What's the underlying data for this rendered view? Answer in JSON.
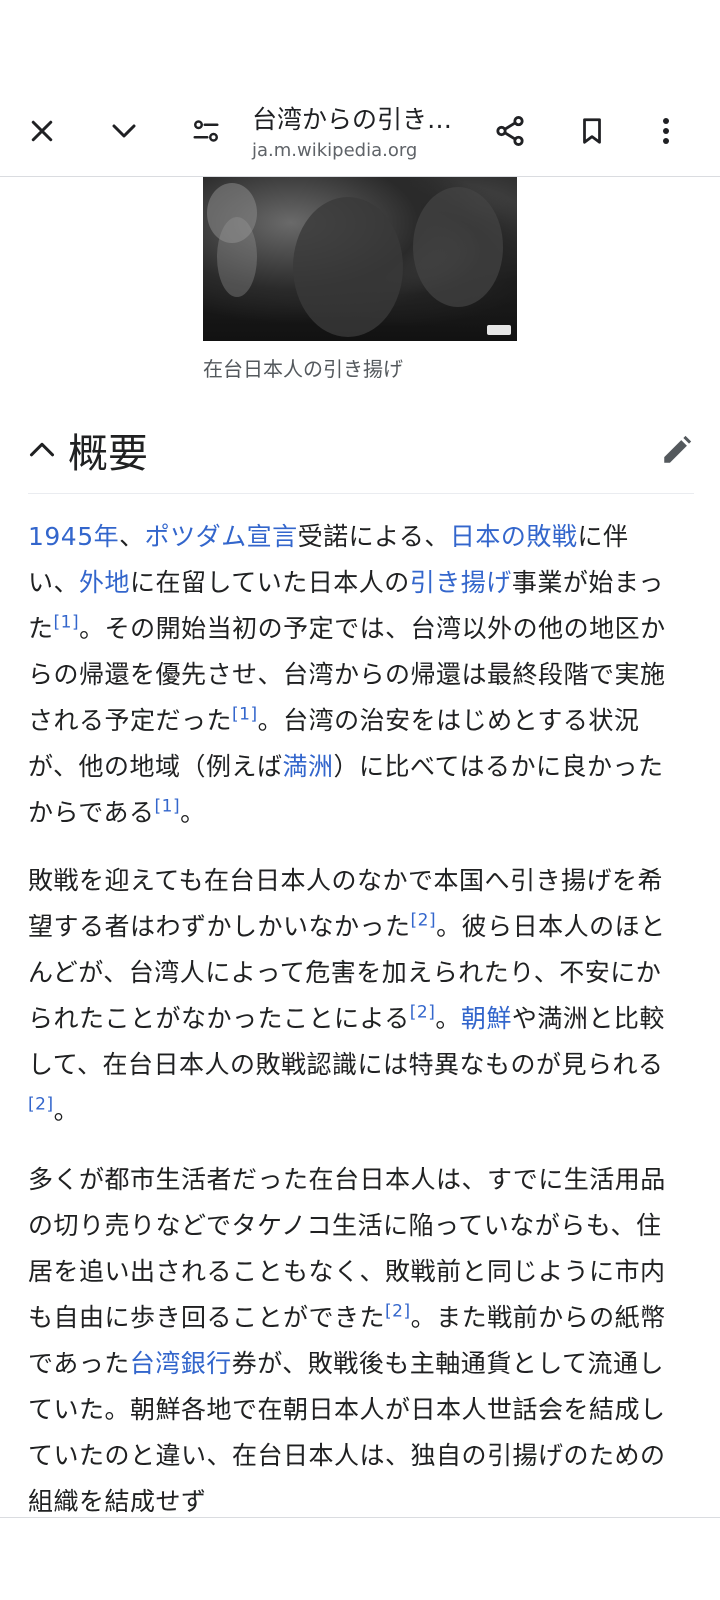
{
  "toolbar": {
    "title": "台湾からの引き…",
    "url": "ja.m.wikipedia.org",
    "icons": [
      "close-icon",
      "chevron-down-icon",
      "page-settings-icon",
      "share-icon",
      "bookmark-icon",
      "more-icon"
    ]
  },
  "figure": {
    "caption": "在台日本人の引き揚げ"
  },
  "section": {
    "title": "概要"
  },
  "paragraphs": {
    "p1": {
      "l1": "1945年",
      "t1": "、",
      "l2": "ポツダム宣言",
      "t2": "受諾による、",
      "l3": "日本の敗戦",
      "t3": "に伴い、",
      "l4": "外地",
      "t4": "に在留していた日本人の",
      "l5": "引き揚げ",
      "t5": "事業が始まった",
      "r1": "[1]",
      "t6": "。その開始当初の予定では、台湾以外の他の地区からの帰還を優先させ、台湾からの帰還は最終段階で実施される予定だった",
      "r2": "[1]",
      "t7": "。台湾の治安をはじめとする状況が、他の地域（例えば",
      "l6": "満洲",
      "t8": "）に比べてはるかに良かったからである",
      "r3": "[1]",
      "t9": "。"
    },
    "p2": {
      "t1": "敗戦を迎えても在台日本人のなかで本国へ引き揚げを希望する者はわずかしかいなかった",
      "r1": "[2]",
      "t2": "。彼ら日本人のほとんどが、台湾人によって危害を加えられたり、不安にかられたことがなかったことによる",
      "r2": "[2]",
      "t3": "。",
      "l1": "朝鮮",
      "t4": "や満洲と比較して、在台日本人の敗戦認識には特異なものが見られる",
      "r3": "[2]",
      "t5": "。"
    },
    "p3": {
      "t1": "多くが都市生活者だった在台日本人は、すでに生活用品の切り売りなどでタケノコ生活に陥っていながらも、住居を追い出されることもなく、敗戦前と同じように市内も自由に歩き回ることができた",
      "r1": "[2]",
      "t2": "。また戦前からの紙幣であった",
      "l1": "台湾銀行",
      "t3": "券が、敗戦後も主軸通貨として流通していた。朝鮮各地で在朝日本人が日本人世話会を結成していたのと違い、在台日本人は、独自の引揚げのための組織を結成せず"
    }
  },
  "colors": {
    "link": "#3366cc",
    "text": "#202122",
    "caption": "#54595d"
  }
}
